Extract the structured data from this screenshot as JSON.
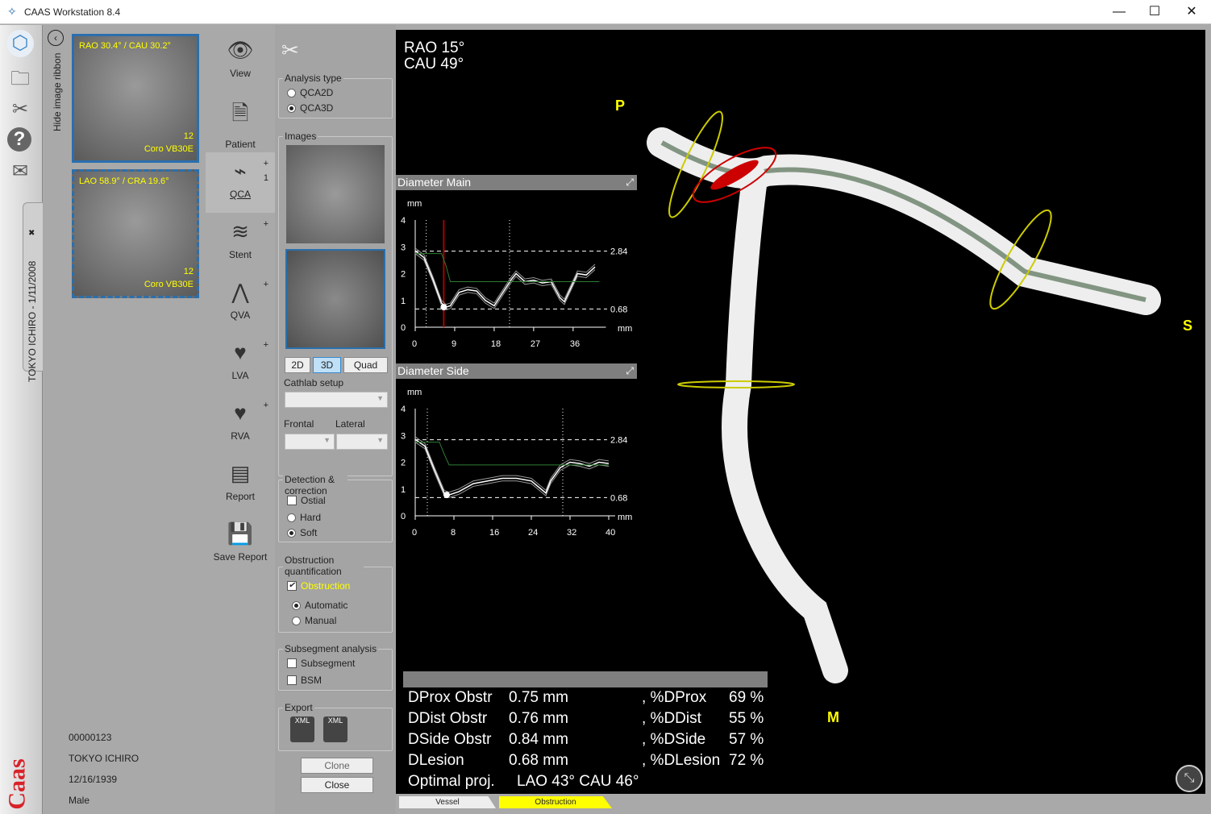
{
  "window": {
    "title": "CAAS Workstation 8.4",
    "minimize": "—",
    "maximize": "☐",
    "close": "✕"
  },
  "left_strip": {
    "icons": [
      "app-logo-icon",
      "folder-icon",
      "tools-icon",
      "help-icon",
      "mail-icon"
    ],
    "patient_tab": "TOKYO ICHIRO - 1/11/2008",
    "brand": "Caas",
    "brand_color": "#d8222a"
  },
  "ribbon": {
    "hide_label": "Hide image ribbon",
    "thumbnails": [
      {
        "angle": "RAO 30.4° / CAU 30.2°",
        "frame": "12",
        "series": "Coro VB30E",
        "selected": true
      },
      {
        "angle": "LAO 58.9° / CRA 19.6°",
        "frame": "12",
        "series": "Coro VB30E",
        "selected": false
      }
    ],
    "patient": {
      "id": "00000123",
      "name": "TOKYO ICHIRO",
      "dob": "12/16/1939",
      "sex": "Male"
    }
  },
  "tools": [
    {
      "label": "View",
      "icon": "eye-icon"
    },
    {
      "label": "Patient",
      "icon": "patient-icon"
    },
    {
      "label": "QCA",
      "icon": "qca-vessel-icon",
      "plus": "+",
      "count": "1",
      "active": true
    },
    {
      "label": "Stent",
      "icon": "stent-icon",
      "plus": "+"
    },
    {
      "label": "QVA",
      "icon": "qva-icon",
      "plus": "+"
    },
    {
      "label": "LVA",
      "icon": "lva-heart-icon",
      "plus": "+"
    },
    {
      "label": "RVA",
      "icon": "rva-heart-icon",
      "plus": "+"
    },
    {
      "label": "Report",
      "icon": "report-icon"
    },
    {
      "label": "Save Report",
      "icon": "save-icon"
    }
  ],
  "options": {
    "analysis_type": {
      "title": "Analysis type",
      "options": [
        "QCA2D",
        "QCA3D"
      ],
      "selected": "QCA3D"
    },
    "images": {
      "title": "Images",
      "view_buttons": [
        "2D",
        "3D",
        "Quad"
      ],
      "active_view": "3D",
      "cathlab_label": "Cathlab setup",
      "cathlab_value": "",
      "frontal_label": "Frontal",
      "lateral_label": "Lateral"
    },
    "detection": {
      "title": "Detection & correction",
      "ostial_label": "Ostial",
      "ostial_checked": false,
      "options": [
        "Hard",
        "Soft"
      ],
      "selected": "Soft"
    },
    "obstruction": {
      "title": "Obstruction quantification",
      "obstruction_label": "Obstruction",
      "obstruction_checked": true,
      "options": [
        "Automatic",
        "Manual"
      ],
      "selected": "Automatic"
    },
    "subsegment": {
      "title": "Subsegment analysis",
      "subsegment_label": "Subsegment",
      "bsm_label": "BSM"
    },
    "export": {
      "title": "Export",
      "icons": [
        "xml-save-icon",
        "xml-edit-icon"
      ]
    },
    "clone_label": "Clone",
    "close_label": "Close"
  },
  "viewer": {
    "projection_line1": "RAO 15°",
    "projection_line2": "CAU 49°",
    "orient_p": "P",
    "orient_s": "S",
    "orient_m": "M"
  },
  "chart_data": [
    {
      "type": "line",
      "title": "Diameter Main",
      "ylabel": "mm",
      "xlabel": "mm",
      "xlim": [
        0,
        42
      ],
      "ylim": [
        0,
        4
      ],
      "xticks": [
        0,
        9,
        18,
        27,
        36
      ],
      "yticks": [
        0,
        1,
        2,
        3,
        4
      ],
      "reference_lines": [
        2.84,
        0.68
      ],
      "reference_labels": [
        "2.84",
        "0.68"
      ],
      "markers": {
        "obstruction_boundaries": [
          2.5,
          21.5
        ],
        "position_line": 6.5,
        "minimum": [
          6.5,
          0.75
        ]
      },
      "series": [
        {
          "role": "diameter",
          "color": "#ffffff",
          "x": [
            0,
            2,
            4,
            6,
            7,
            8,
            10,
            12,
            14,
            16,
            18,
            20,
            22,
            23,
            25,
            27,
            29,
            31,
            32,
            33,
            34,
            35,
            37,
            39,
            41
          ],
          "y": [
            2.85,
            2.6,
            1.8,
            0.9,
            0.75,
            0.8,
            1.3,
            1.4,
            1.35,
            1.0,
            0.8,
            1.3,
            1.8,
            2.0,
            1.7,
            1.75,
            1.65,
            1.7,
            1.4,
            1.1,
            0.95,
            1.3,
            2.0,
            1.95,
            2.25
          ]
        },
        {
          "role": "reference",
          "color": "#2e7d32",
          "x": [
            0,
            6,
            7,
            8,
            42
          ],
          "y": [
            2.75,
            2.75,
            2.3,
            1.7,
            1.7
          ]
        }
      ]
    },
    {
      "type": "line",
      "title": "Diameter Side",
      "ylabel": "mm",
      "xlabel": "mm",
      "xlim": [
        0,
        40
      ],
      "ylim": [
        0,
        4
      ],
      "xticks": [
        0,
        8,
        16,
        24,
        32,
        40
      ],
      "yticks": [
        0,
        1,
        2,
        3,
        4
      ],
      "reference_lines": [
        2.84,
        0.68
      ],
      "reference_labels": [
        "2.84",
        "0.68"
      ],
      "markers": {
        "obstruction_boundaries": [
          2.5,
          30.5
        ],
        "minimum": [
          6.5,
          0.78
        ]
      },
      "series": [
        {
          "role": "diameter",
          "color": "#ffffff",
          "x": [
            0,
            2,
            4,
            6,
            7,
            9,
            12,
            15,
            18,
            21,
            24,
            26,
            27,
            28,
            30,
            32,
            34,
            36,
            38,
            40
          ],
          "y": [
            2.85,
            2.6,
            1.7,
            0.85,
            0.78,
            0.9,
            1.2,
            1.3,
            1.4,
            1.4,
            1.3,
            1.0,
            0.85,
            1.3,
            1.8,
            2.0,
            1.95,
            1.85,
            2.0,
            1.95
          ]
        },
        {
          "role": "reference",
          "color": "#2e7d32",
          "x": [
            0,
            5,
            6,
            7,
            40
          ],
          "y": [
            2.75,
            2.75,
            2.3,
            1.9,
            1.9
          ]
        }
      ]
    }
  ],
  "results": [
    {
      "label": "DProx Obstr",
      "value": "0.75 mm",
      "plabel": ", %DProx",
      "pvalue": "69 %"
    },
    {
      "label": "DDist Obstr",
      "value": "0.76 mm",
      "plabel": ", %DDist",
      "pvalue": "55 %"
    },
    {
      "label": "DSide Obstr",
      "value": "0.84 mm",
      "plabel": ", %DSide",
      "pvalue": "57 %"
    },
    {
      "label": "DLesion",
      "value": "0.68 mm",
      "plabel": ", %DLesion",
      "pvalue": "72 %"
    }
  ],
  "optimal": {
    "label": "Optimal proj.",
    "value": "LAO 43° CAU 46°"
  },
  "tabs": [
    {
      "label": "Vessel",
      "active": false
    },
    {
      "label": "Obstruction",
      "active": true
    }
  ],
  "accent": "#ffff00"
}
